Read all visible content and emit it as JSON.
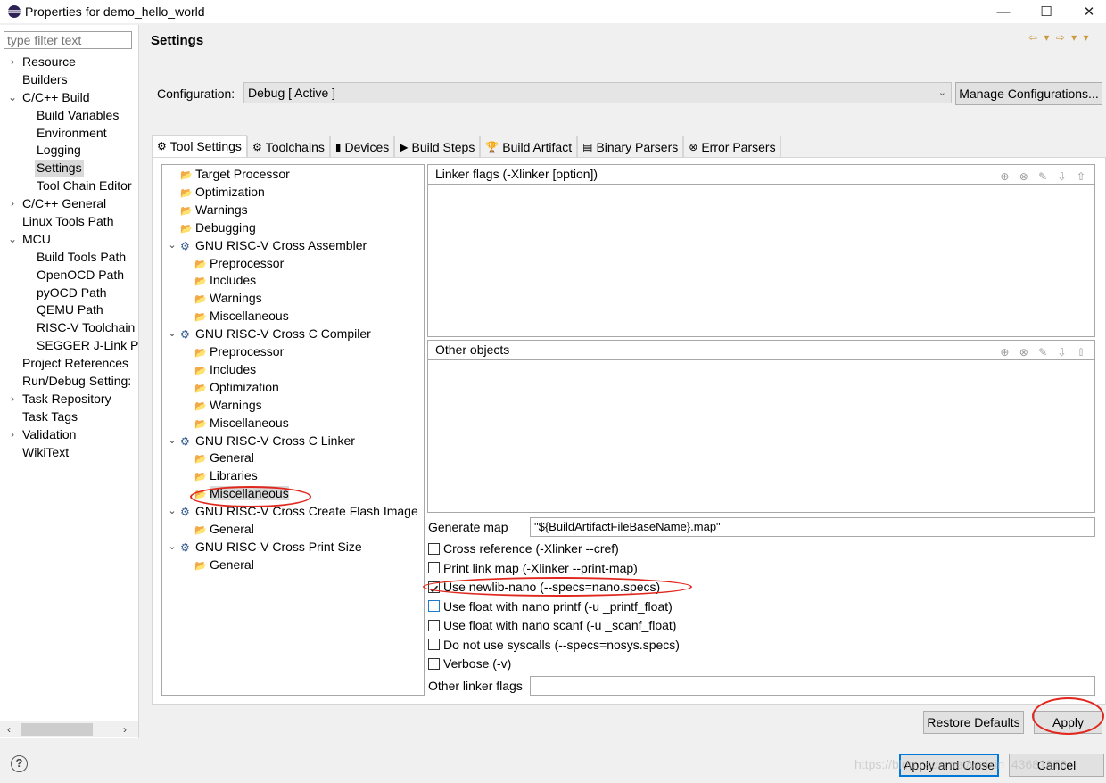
{
  "window": {
    "title": "Properties for demo_hello_world",
    "minimize_glyph": "—",
    "maximize_glyph": "☐",
    "close_glyph": "✕"
  },
  "left_nav": {
    "filter_placeholder": "type filter text",
    "items": [
      {
        "label": "Resource",
        "twisty": "›"
      },
      {
        "label": "Builders",
        "twisty": ""
      },
      {
        "label": "C/C++ Build",
        "twisty": "⌄"
      },
      {
        "label": "Build Variables",
        "twisty": ""
      },
      {
        "label": "Environment",
        "twisty": ""
      },
      {
        "label": "Logging",
        "twisty": ""
      },
      {
        "label": "Settings",
        "twisty": "",
        "selected": true
      },
      {
        "label": "Tool Chain Editor",
        "twisty": ""
      },
      {
        "label": "C/C++ General",
        "twisty": "›"
      },
      {
        "label": "Linux Tools Path",
        "twisty": ""
      },
      {
        "label": "MCU",
        "twisty": "⌄"
      },
      {
        "label": "Build Tools Path",
        "twisty": ""
      },
      {
        "label": "OpenOCD Path",
        "twisty": ""
      },
      {
        "label": "pyOCD Path",
        "twisty": ""
      },
      {
        "label": "QEMU Path",
        "twisty": ""
      },
      {
        "label": "RISC-V Toolchain",
        "twisty": ""
      },
      {
        "label": "SEGGER J-Link Pa",
        "twisty": ""
      },
      {
        "label": "Project References",
        "twisty": ""
      },
      {
        "label": "Run/Debug Setting:",
        "twisty": ""
      },
      {
        "label": "Task Repository",
        "twisty": "›"
      },
      {
        "label": "Task Tags",
        "twisty": ""
      },
      {
        "label": "Validation",
        "twisty": "›"
      },
      {
        "label": "WikiText",
        "twisty": ""
      }
    ],
    "scroll_left": "‹",
    "scroll_right": "›"
  },
  "header": {
    "title": "Settings",
    "nav_arrows": "⇦ ▾ ⇨ ▾ ▾"
  },
  "configuration": {
    "label": "Configuration:",
    "value": "Debug  [ Active ]",
    "dropdown_arrow": "⌄",
    "manage_label": "Manage Configurations..."
  },
  "tabs": [
    {
      "label": "Tool Settings",
      "icon": "⚙",
      "active": true
    },
    {
      "label": "Toolchains",
      "icon": "⚙"
    },
    {
      "label": "Devices",
      "icon": "▮"
    },
    {
      "label": "Build Steps",
      "icon": "▶"
    },
    {
      "label": "Build Artifact",
      "icon": "🏆"
    },
    {
      "label": "Binary Parsers",
      "icon": "▤"
    },
    {
      "label": "Error Parsers",
      "icon": "⊗"
    }
  ],
  "tree": [
    {
      "label": "Target Processor",
      "level": 0,
      "icon": "option-folder"
    },
    {
      "label": "Optimization",
      "level": 0,
      "icon": "option-folder"
    },
    {
      "label": "Warnings",
      "level": 0,
      "icon": "option-folder"
    },
    {
      "label": "Debugging",
      "level": 0,
      "icon": "option-folder"
    },
    {
      "label": "GNU RISC-V Cross Assembler",
      "level": 0,
      "icon": "tool-gear",
      "twisty": "⌄"
    },
    {
      "label": "Preprocessor",
      "level": 1,
      "icon": "option-folder"
    },
    {
      "label": "Includes",
      "level": 1,
      "icon": "option-folder"
    },
    {
      "label": "Warnings",
      "level": 1,
      "icon": "option-folder"
    },
    {
      "label": "Miscellaneous",
      "level": 1,
      "icon": "option-folder"
    },
    {
      "label": "GNU RISC-V Cross C Compiler",
      "level": 0,
      "icon": "tool-gear",
      "twisty": "⌄"
    },
    {
      "label": "Preprocessor",
      "level": 1,
      "icon": "option-folder"
    },
    {
      "label": "Includes",
      "level": 1,
      "icon": "option-folder"
    },
    {
      "label": "Optimization",
      "level": 1,
      "icon": "option-folder"
    },
    {
      "label": "Warnings",
      "level": 1,
      "icon": "option-folder"
    },
    {
      "label": "Miscellaneous",
      "level": 1,
      "icon": "option-folder"
    },
    {
      "label": "GNU RISC-V Cross C Linker",
      "level": 0,
      "icon": "tool-gear",
      "twisty": "⌄"
    },
    {
      "label": "General",
      "level": 1,
      "icon": "option-folder"
    },
    {
      "label": "Libraries",
      "level": 1,
      "icon": "option-folder"
    },
    {
      "label": "Miscellaneous",
      "level": 1,
      "icon": "option-folder",
      "selected": true
    },
    {
      "label": "GNU RISC-V Cross Create Flash Image",
      "level": 0,
      "icon": "tool-gear",
      "twisty": "⌄"
    },
    {
      "label": "General",
      "level": 1,
      "icon": "option-folder"
    },
    {
      "label": "GNU RISC-V Cross Print Size",
      "level": 0,
      "icon": "tool-gear",
      "twisty": "⌄"
    },
    {
      "label": "General",
      "level": 1,
      "icon": "option-folder"
    }
  ],
  "linker_panel": {
    "linker_flags_title": "Linker flags (-Xlinker [option])",
    "other_objects_title": "Other objects",
    "list_tools": "⊕ ⊗ ✎ ⇩ ⇧",
    "generate_map_label": "Generate map",
    "generate_map_value": "\"${BuildArtifactFileBaseName}.map\"",
    "checkboxes": [
      {
        "label": "Cross reference (-Xlinker --cref)",
        "checked": false
      },
      {
        "label": "Print link map (-Xlinker --print-map)",
        "checked": false
      },
      {
        "label": "Use newlib-nano (--specs=nano.specs)",
        "checked": true
      },
      {
        "label": "Use float with nano printf (-u _printf_float)",
        "checked": false,
        "focused": true
      },
      {
        "label": "Use float with nano scanf (-u _scanf_float)",
        "checked": false
      },
      {
        "label": "Do not use syscalls (--specs=nosys.specs)",
        "checked": false
      },
      {
        "label": "Verbose (-v)",
        "checked": false
      }
    ],
    "other_flags_label": "Other linker flags",
    "other_flags_value": ""
  },
  "footer": {
    "restore_defaults": "Restore Defaults",
    "apply": "Apply",
    "apply_and_close": "Apply and Close",
    "cancel": "Cancel",
    "help_glyph": "?",
    "watermark": "https://blog.csdn.net/weixin_43681878"
  },
  "colors": {
    "annotation": "#e0281e",
    "selection": "#d9d9d9",
    "primary_border": "#0078d7"
  }
}
